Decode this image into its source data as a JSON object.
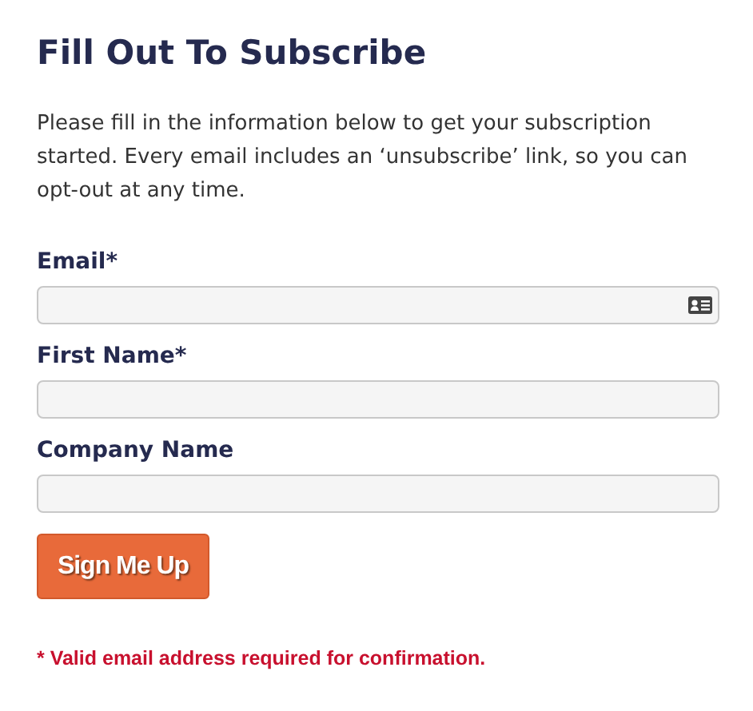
{
  "title": "Fill Out To Subscribe",
  "intro": "Please fill in the information below to get your subscription started. Every email includes an ‘unsubscribe’ link, so you can opt-out at any time.",
  "fields": [
    {
      "label": "Email*",
      "kind": "contact"
    },
    {
      "label": "First Name*",
      "kind": "plain"
    },
    {
      "label": "Company Name",
      "kind": "plain"
    }
  ],
  "button": "Sign Me Up",
  "note": "* Valid email address required for confirmation."
}
